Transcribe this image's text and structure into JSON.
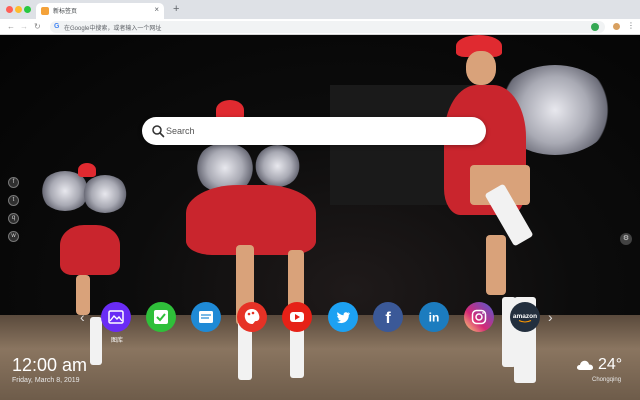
{
  "browser": {
    "tab_title": "新标签页",
    "tab_close": "×",
    "new_tab": "+",
    "address_placeholder": "在Google中搜索，或者输入一个网址",
    "menu": "⋮"
  },
  "search": {
    "placeholder": "Search"
  },
  "quick_links": [
    {
      "name": "gallery",
      "label": "图库",
      "glyph": "",
      "color": "#6a2cf5"
    },
    {
      "name": "checklist",
      "label": "",
      "glyph": "",
      "color": "#2fbf3a"
    },
    {
      "name": "notes",
      "label": "",
      "glyph": "",
      "color": "#1f8ad6"
    },
    {
      "name": "paint",
      "label": "",
      "glyph": "",
      "color": "#e63226"
    },
    {
      "name": "youtube",
      "label": "",
      "glyph": "",
      "color": "#e62117"
    },
    {
      "name": "twitter",
      "label": "",
      "glyph": "",
      "color": "#1da1f2"
    },
    {
      "name": "facebook",
      "label": "",
      "glyph": "f",
      "color": "#3b5998"
    },
    {
      "name": "linkedin",
      "label": "",
      "glyph": "in",
      "color": "#1c7cbf"
    },
    {
      "name": "instagram",
      "label": "",
      "glyph": "",
      "color": "#d6249f"
    },
    {
      "name": "amazon",
      "label": "",
      "glyph": "amazon",
      "color": "#232f3e"
    }
  ],
  "nav_arrows": {
    "left": "‹",
    "right": "›"
  },
  "clock": {
    "time": "12:00 am",
    "date": "Friday, March 8, 2019"
  },
  "weather": {
    "temp": "24°",
    "city": "Chongqing"
  }
}
